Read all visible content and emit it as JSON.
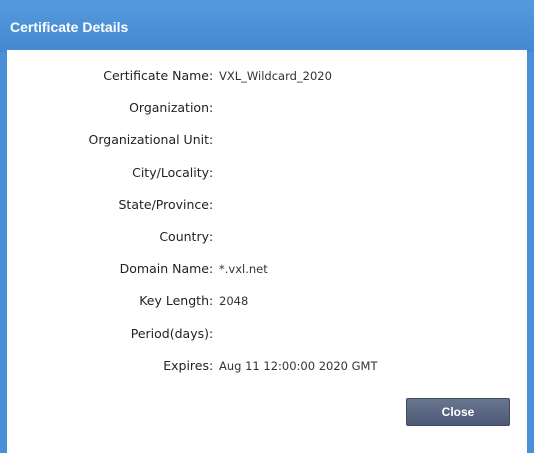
{
  "dialog": {
    "title": "Certificate Details",
    "close_label": "Close"
  },
  "fields": [
    {
      "label": "Certificate Name",
      "value": "VXL_Wildcard_2020"
    },
    {
      "label": "Organization",
      "value": ""
    },
    {
      "label": "Organizational Unit",
      "value": ""
    },
    {
      "label": "City/Locality",
      "value": ""
    },
    {
      "label": "State/Province",
      "value": ""
    },
    {
      "label": "Country",
      "value": ""
    },
    {
      "label": "Domain Name",
      "value": "*.vxl.net"
    },
    {
      "label": "Key Length",
      "value": "2048"
    },
    {
      "label": "Period(days)",
      "value": ""
    },
    {
      "label": "Expires",
      "value": "Aug 11 12:00:00 2020 GMT"
    }
  ],
  "colors": {
    "titlebar": "#4a90d9",
    "button": "#5a6580"
  }
}
